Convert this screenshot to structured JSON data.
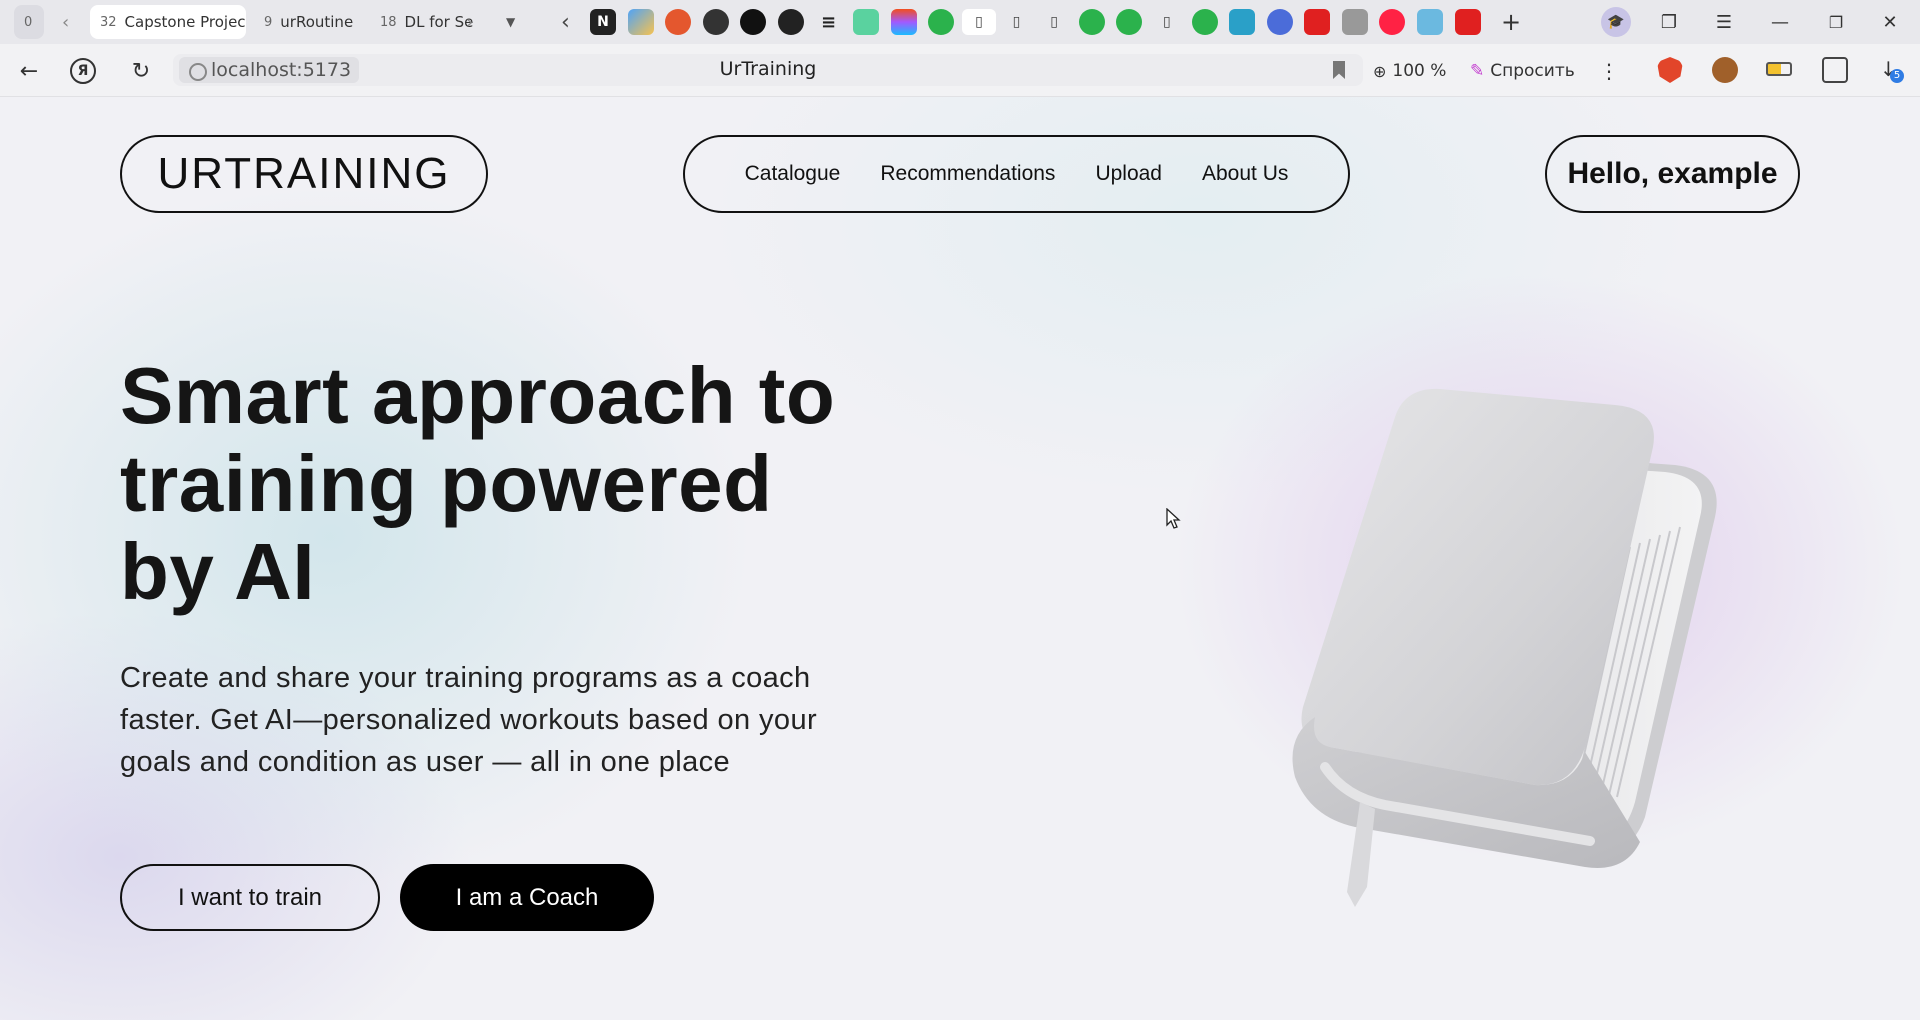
{
  "browser": {
    "tabs": [
      {
        "count": "0",
        "title": ""
      },
      {
        "count": "32",
        "title": "Capstone Projec"
      },
      {
        "count": "9",
        "title": "urRoutine"
      },
      {
        "count": "18",
        "title": "DL for Se"
      }
    ],
    "favicons": [
      "notion-icon",
      "app-icon",
      "opera-icon",
      "github-outline-icon",
      "github-icon",
      "openai-icon",
      "lines-icon",
      "dev-icon",
      "figma-icon",
      "feedly-icon",
      "file-icon",
      "file-icon",
      "file-icon",
      "feedly-icon",
      "feedly-icon",
      "file-icon",
      "feedly-icon",
      "badge-icon",
      "bluesky-icon",
      "youtube-icon",
      "app-icon",
      "yandex-icon",
      "app-icon",
      "youtube-icon"
    ],
    "address": {
      "host": "localhost:5173",
      "title": "UrTraining"
    },
    "zoom": "100 %",
    "ask_label": "Спросить",
    "downloads_badge": "5"
  },
  "header": {
    "logo": "URTRAINING",
    "nav": [
      "Catalogue",
      "Recommendations",
      "Upload",
      "About Us"
    ],
    "greeting": "Hello, example"
  },
  "hero": {
    "title_lines": [
      "Smart approach to",
      "training powered",
      "by AI"
    ],
    "subtitle_lines": [
      "Create and share your training programs as a coach",
      "faster. Get AI—personalized workouts based on your",
      "goals and condition as user — all in one place"
    ],
    "cta_train": "I want to train",
    "cta_coach": "I am a Coach"
  }
}
